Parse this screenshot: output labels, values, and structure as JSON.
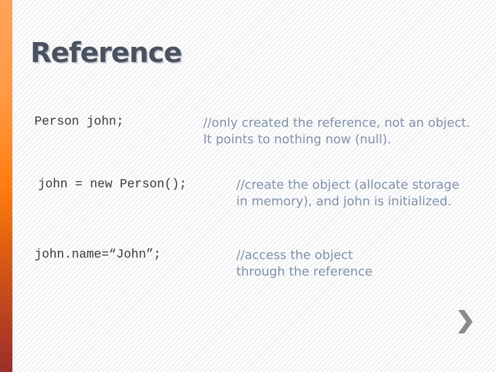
{
  "slide": {
    "title": "Reference",
    "rows": [
      {
        "code": "Person john;",
        "comment": "//only created the reference, not an object. It points to nothing now (null)."
      },
      {
        "code": "john = new Person();",
        "comment": "//create the object (allocate storage in memory), and john is initialized."
      },
      {
        "code": "john.name=“John”;",
        "comment": "//access the object through the reference"
      }
    ]
  },
  "navigation": {
    "next_icon": "chevron-right-icon"
  },
  "colors": {
    "title": "#4a5260",
    "code": "#3a3a3a",
    "comment": "#7f91a8",
    "accent_top": "#ffa35a",
    "accent_mid": "#ff7d12",
    "accent_bottom": "#9c2e2c",
    "chevron": "#8e8a86"
  }
}
